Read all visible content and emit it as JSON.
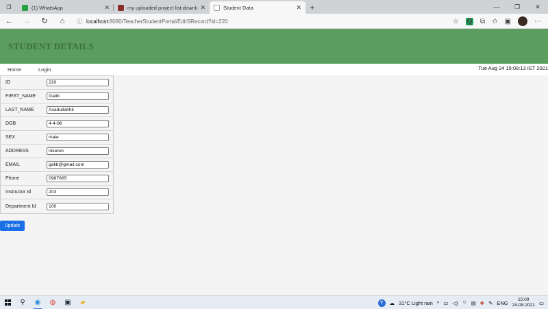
{
  "browser": {
    "tabs": [
      {
        "title": "(1) WhatsApp",
        "icon": "whatsapp-icon",
        "color": "#25a244",
        "active": false
      },
      {
        "title": "my uploaded project list.downlo",
        "icon": "document-icon",
        "color": "#8a2b2b",
        "active": false
      },
      {
        "title": "Student Data",
        "icon": "page-icon",
        "color": "#999999",
        "active": true
      }
    ],
    "new_tab": "+",
    "url_host": "localhost",
    "url_path": ":8080/TeacherStudentPortal/EditSRecord?id=220"
  },
  "page": {
    "title": "STUDENT DETAILS",
    "header_color": "#5a9d5e",
    "nav": {
      "home": "Home",
      "login": "Login"
    },
    "datetime": "Tue Aug 24 15:09:13 IST 2021",
    "fields": [
      {
        "label": "ID",
        "value": "220"
      },
      {
        "label": "FIRST_NAME",
        "value": "Galib"
      },
      {
        "label": "LAST_NAME",
        "value": "Asadullahhil"
      },
      {
        "label": "DOB",
        "value": "4-4-96"
      },
      {
        "label": "SEX",
        "value": "male"
      },
      {
        "label": "ADDRESS",
        "value": "niketon"
      },
      {
        "label": "EMAIL",
        "value": "galib@gmail.com"
      },
      {
        "label": "Phone",
        "value": "0987665"
      },
      {
        "label": "Instructor Id",
        "value": "203"
      },
      {
        "label": "Department Id",
        "value": "100"
      }
    ],
    "update_label": "Update",
    "update_color": "#1a6fe6"
  },
  "taskbar": {
    "weather": "31°C  Light rain",
    "language": "ENG",
    "time": "15:09",
    "date": "24-08-2021"
  }
}
